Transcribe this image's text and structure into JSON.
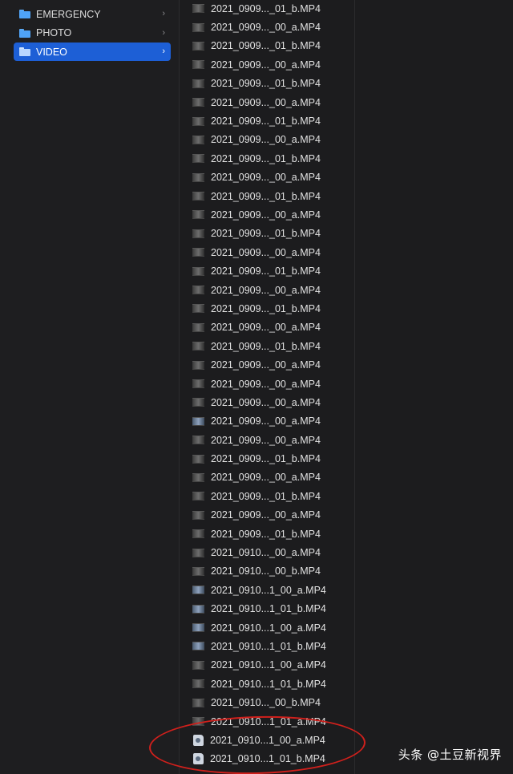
{
  "folders": [
    {
      "label": "EMERGENCY",
      "selected": false
    },
    {
      "label": "PHOTO",
      "selected": false
    },
    {
      "label": "VIDEO",
      "selected": true
    }
  ],
  "chevron": "›",
  "files": [
    {
      "name": "2021_0909..._01_b.MP4",
      "icon": "video-thumbnail"
    },
    {
      "name": "2021_0909..._00_a.MP4",
      "icon": "video-thumbnail"
    },
    {
      "name": "2021_0909..._01_b.MP4",
      "icon": "video-thumbnail"
    },
    {
      "name": "2021_0909..._00_a.MP4",
      "icon": "video-thumbnail"
    },
    {
      "name": "2021_0909..._01_b.MP4",
      "icon": "video-thumbnail"
    },
    {
      "name": "2021_0909..._00_a.MP4",
      "icon": "video-thumbnail"
    },
    {
      "name": "2021_0909..._01_b.MP4",
      "icon": "video-thumbnail"
    },
    {
      "name": "2021_0909..._00_a.MP4",
      "icon": "video-thumbnail"
    },
    {
      "name": "2021_0909..._01_b.MP4",
      "icon": "video-thumbnail"
    },
    {
      "name": "2021_0909..._00_a.MP4",
      "icon": "video-thumbnail"
    },
    {
      "name": "2021_0909..._01_b.MP4",
      "icon": "video-thumbnail"
    },
    {
      "name": "2021_0909..._00_a.MP4",
      "icon": "video-thumbnail"
    },
    {
      "name": "2021_0909..._01_b.MP4",
      "icon": "video-thumbnail"
    },
    {
      "name": "2021_0909..._00_a.MP4",
      "icon": "video-thumbnail"
    },
    {
      "name": "2021_0909..._01_b.MP4",
      "icon": "video-thumbnail"
    },
    {
      "name": "2021_0909..._00_a.MP4",
      "icon": "video-thumbnail"
    },
    {
      "name": "2021_0909..._01_b.MP4",
      "icon": "video-thumbnail"
    },
    {
      "name": "2021_0909..._00_a.MP4",
      "icon": "video-thumbnail"
    },
    {
      "name": "2021_0909..._01_b.MP4",
      "icon": "video-thumbnail"
    },
    {
      "name": "2021_0909..._00_a.MP4",
      "icon": "video-thumbnail"
    },
    {
      "name": "2021_0909..._00_a.MP4",
      "icon": "video-thumbnail"
    },
    {
      "name": "2021_0909..._00_a.MP4",
      "icon": "video-thumbnail"
    },
    {
      "name": "2021_0909..._00_a.MP4",
      "icon": "video-thumbnail-blue"
    },
    {
      "name": "2021_0909..._00_a.MP4",
      "icon": "video-thumbnail"
    },
    {
      "name": "2021_0909..._01_b.MP4",
      "icon": "video-thumbnail"
    },
    {
      "name": "2021_0909..._00_a.MP4",
      "icon": "video-thumbnail"
    },
    {
      "name": "2021_0909..._01_b.MP4",
      "icon": "video-thumbnail"
    },
    {
      "name": "2021_0909..._00_a.MP4",
      "icon": "video-thumbnail"
    },
    {
      "name": "2021_0909..._01_b.MP4",
      "icon": "video-thumbnail"
    },
    {
      "name": "2021_0910..._00_a.MP4",
      "icon": "video-thumbnail"
    },
    {
      "name": "2021_0910..._00_b.MP4",
      "icon": "video-thumbnail"
    },
    {
      "name": "2021_0910...1_00_a.MP4",
      "icon": "video-thumbnail-blue"
    },
    {
      "name": "2021_0910...1_01_b.MP4",
      "icon": "video-thumbnail-blue"
    },
    {
      "name": "2021_0910...1_00_a.MP4",
      "icon": "video-thumbnail-blue"
    },
    {
      "name": "2021_0910...1_01_b.MP4",
      "icon": "video-thumbnail-blue"
    },
    {
      "name": "2021_0910...1_00_a.MP4",
      "icon": "video-thumbnail"
    },
    {
      "name": "2021_0910...1_01_b.MP4",
      "icon": "video-thumbnail"
    },
    {
      "name": "2021_0910..._00_b.MP4",
      "icon": "video-thumbnail"
    },
    {
      "name": "2021_0910...1_01_a.MP4",
      "icon": "video-thumbnail"
    },
    {
      "name": "2021_0910...1_00_a.MP4",
      "icon": "quicktime-file"
    },
    {
      "name": "2021_0910...1_01_b.MP4",
      "icon": "quicktime-file"
    }
  ],
  "watermark": "头条 @土豆新视界",
  "colors": {
    "selection": "#1d5fd6",
    "annotation": "#d0201c",
    "folder": "#4fa3f7"
  }
}
